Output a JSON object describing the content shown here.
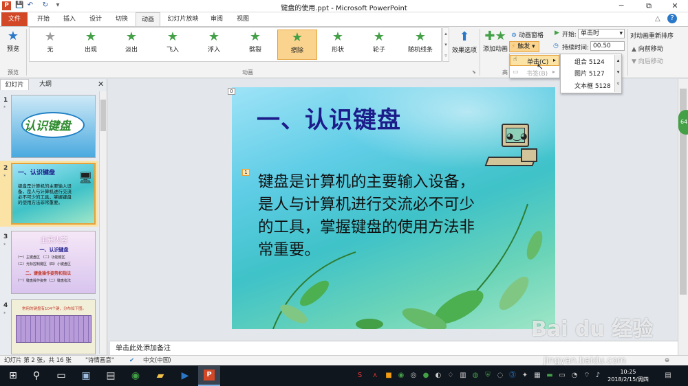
{
  "titlebar": {
    "title": "键盘的使用.ppt - Microsoft PowerPoint",
    "minimize": "─",
    "restore": "⧉",
    "close": "✕"
  },
  "quick_access": {
    "save": "💾",
    "undo": "↶",
    "redo": "↻",
    "customize": "▾"
  },
  "tabs": [
    {
      "label": "文件"
    },
    {
      "label": "开始"
    },
    {
      "label": "插入"
    },
    {
      "label": "设计"
    },
    {
      "label": "切换"
    },
    {
      "label": "动画"
    },
    {
      "label": "幻灯片放映"
    },
    {
      "label": "审阅"
    },
    {
      "label": "视图"
    }
  ],
  "ribbon": {
    "preview": {
      "label": "预览",
      "group": "预览"
    },
    "animation_group": "动画",
    "effects": [
      {
        "label": "无",
        "icon": "star-none"
      },
      {
        "label": "出现",
        "icon": "star"
      },
      {
        "label": "淡出",
        "icon": "star"
      },
      {
        "label": "飞入",
        "icon": "star"
      },
      {
        "label": "浮入",
        "icon": "star"
      },
      {
        "label": "劈裂",
        "icon": "star"
      },
      {
        "label": "擦除",
        "icon": "star"
      },
      {
        "label": "形状",
        "icon": "star"
      },
      {
        "label": "轮子",
        "icon": "star"
      },
      {
        "label": "随机线条",
        "icon": "star"
      }
    ],
    "effect_options": "效果选项",
    "add_animation": "添加动画",
    "advanced_group_partial": "高",
    "animation_pane": "动画窗格",
    "trigger": "触发",
    "start_label": "开始:",
    "start_value": "单击时",
    "duration_label": "持续时间:",
    "duration_value": "00.50",
    "reorder_label": "对动画重新排序",
    "move_earlier": "向前移动",
    "move_later": "向后移动"
  },
  "trigger_menu": {
    "on_click": "单击(C)",
    "bookmark": "书签(B)"
  },
  "submenu": {
    "items": [
      "组合 5124",
      "图片 5127",
      "文本框 5128"
    ]
  },
  "left_panel": {
    "tab_slides": "幻灯片",
    "tab_outline": "大纲",
    "slides": [
      {
        "num": "1",
        "title": "认识键盘"
      },
      {
        "num": "2",
        "title": "一、认识键盘",
        "body": "键盘是计算机的主要输入设备，是人与计算机进行交流必不可少的工具，掌握键盘的使用方法非常重要。"
      },
      {
        "num": "3",
        "title": "主要内容",
        "line1": "一、认识键盘",
        "line2": "（一）主键盘区 （二）功能键区",
        "line3": "（三）光标控制键区（四）小键盘区",
        "line4": "二、键盘操作姿势和指法",
        "line5": "（一）键盘操作姿势（二）键盘指法"
      },
      {
        "num": "4",
        "title": "常用的键盘有104个键，分布如下图。"
      }
    ]
  },
  "slide": {
    "title": "一、认识键盘",
    "body": "键盘是计算机的主要输入设备，是人与计算机进行交流必不可少的工具，掌握键盘的使用方法非常重要。",
    "anim_tag_title": "0",
    "anim_tag_body": "1"
  },
  "notes_placeholder": "单击此处添加备注",
  "statusbar": {
    "slide_info": "幻灯片 第 2 张，共 16 张",
    "theme": "\"诗情画意\"",
    "language": "中文(中国)"
  },
  "taskbar": {
    "time": "10:25",
    "date": "2018/2/15/周四"
  },
  "watermark": {
    "text": "Bai du 经验",
    "url": "jingyan.baidu.com"
  }
}
